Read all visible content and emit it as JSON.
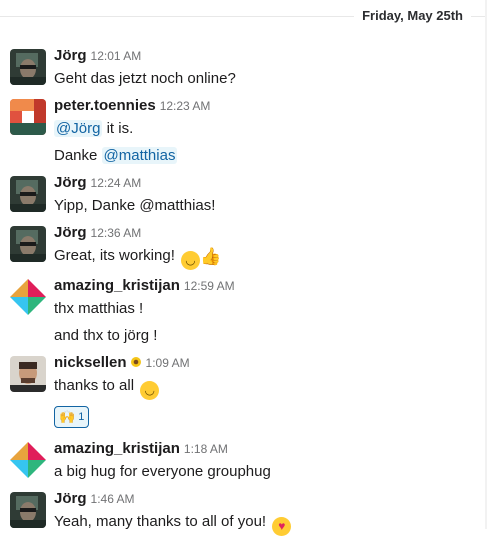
{
  "date_divider": "Friday, May 25th",
  "messages": [
    {
      "author": "Jörg",
      "time": "12:01 AM",
      "lines": [
        {
          "text": "Geht das jetzt noch online?"
        }
      ]
    },
    {
      "author": "peter.toennies",
      "time": "12:23 AM",
      "lines": [
        {
          "mention": "@Jörg",
          "text": " it is."
        },
        {
          "pre": "Danke ",
          "mention": "@matthias"
        }
      ]
    },
    {
      "author": "Jörg",
      "time": "12:24 AM",
      "lines": [
        {
          "text": "Yipp, Danke @matthias!"
        }
      ]
    },
    {
      "author": "Jörg",
      "time": "12:36 AM",
      "lines": [
        {
          "text": "Great, its working! "
        }
      ]
    },
    {
      "author": "amazing_kristijan",
      "time": "12:59 AM",
      "lines": [
        {
          "text": "thx matthias !"
        },
        {
          "text": "and thx to jörg !"
        }
      ]
    },
    {
      "author": "nicksellen",
      "time": "1:09 AM",
      "lines": [
        {
          "text": "thanks to all "
        }
      ],
      "reaction": {
        "emoji": "raised-hands",
        "count": "1"
      }
    },
    {
      "author": "amazing_kristijan",
      "time": "1:18 AM",
      "lines": [
        {
          "text": "a big hug for everyone grouphug"
        }
      ]
    },
    {
      "author": "Jörg",
      "time": "1:46 AM",
      "lines": [
        {
          "text": "Yeah, many thanks to all of you! "
        }
      ]
    }
  ],
  "colors": {
    "mention_text": "#1264a3",
    "mention_bg": "#e8f5fa",
    "timestamp": "#717274",
    "author": "#1d1c1d"
  }
}
